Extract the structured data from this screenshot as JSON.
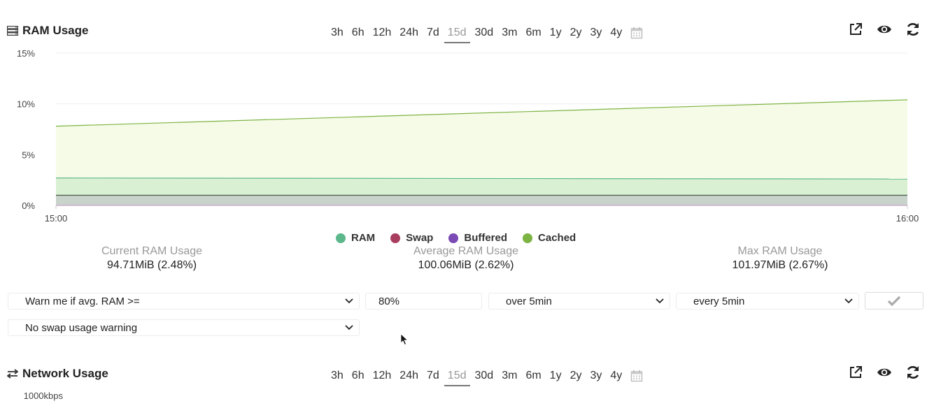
{
  "ram_panel": {
    "title": "RAM Usage",
    "icon": "server-icon",
    "ranges": [
      "3h",
      "6h",
      "12h",
      "24h",
      "7d",
      "15d",
      "30d",
      "3m",
      "6m",
      "1y",
      "2y",
      "3y",
      "4y"
    ],
    "active_range": "15d",
    "tools": [
      "external-link-icon",
      "eye-icon",
      "refresh-icon"
    ]
  },
  "chart_data": {
    "type": "area",
    "x": [
      "15:00",
      "16:00"
    ],
    "y_ticks": [
      "15%",
      "10%",
      "5%",
      "0%"
    ],
    "ylim": [
      0,
      15
    ],
    "series": [
      {
        "name": "RAM",
        "values": [
          2.7,
          2.6
        ],
        "color": "#5cb88a"
      },
      {
        "name": "Swap",
        "values": [
          0.0,
          0.0
        ],
        "color": "#a83d5e"
      },
      {
        "name": "Buffered",
        "values": [
          1.0,
          1.0
        ],
        "color": "#7a4ab5"
      },
      {
        "name": "Cached",
        "values": [
          7.8,
          10.4
        ],
        "color": "#7cb342"
      }
    ],
    "legend_position": "bottom-center",
    "grid": true
  },
  "stats": {
    "current": {
      "label": "Current RAM Usage",
      "value": "94.71MiB (2.48%)"
    },
    "average": {
      "label": "Average RAM Usage",
      "value": "100.06MiB (2.62%)"
    },
    "max": {
      "label": "Max RAM Usage",
      "value": "101.97MiB (2.67%)"
    }
  },
  "alert": {
    "condition": "Warn me if avg. RAM >=",
    "threshold": "80%",
    "duration": "over 5min",
    "frequency": "every 5min",
    "swap": "No swap usage warning"
  },
  "network_panel": {
    "title": "Network Usage",
    "icon": "arrows-exchange-icon",
    "ranges": [
      "3h",
      "6h",
      "12h",
      "24h",
      "7d",
      "15d",
      "30d",
      "3m",
      "6m",
      "1y",
      "2y",
      "3y",
      "4y"
    ],
    "active_range": "15d",
    "y_top_label": "1000kbps"
  }
}
